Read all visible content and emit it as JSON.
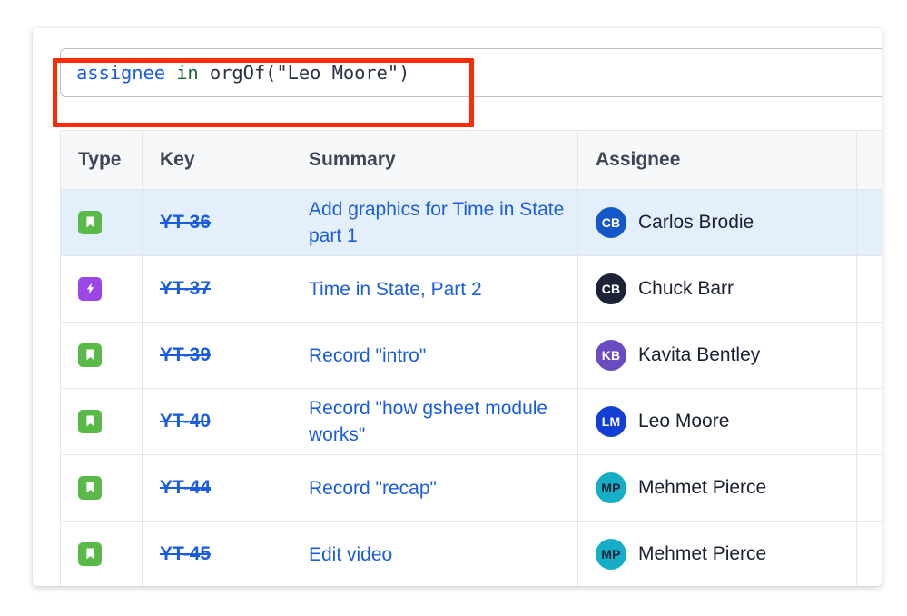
{
  "query": {
    "tokens": [
      {
        "text": "assignee",
        "kind": "field"
      },
      {
        "text": " ",
        "kind": "plain"
      },
      {
        "text": "in",
        "kind": "operator"
      },
      {
        "text": " ",
        "kind": "plain"
      },
      {
        "text": "orgOf(\"Leo Moore\")",
        "kind": "plain"
      }
    ],
    "full_text": "assignee in orgOf(\"Leo Moore\")",
    "annotation_color": "#fb2b05"
  },
  "table": {
    "columns": [
      {
        "key": "type",
        "label": "Type"
      },
      {
        "key": "key",
        "label": "Key"
      },
      {
        "key": "summary",
        "label": "Summary"
      },
      {
        "key": "assignee",
        "label": "Assignee"
      }
    ],
    "rows": [
      {
        "type_icon": "story-icon",
        "type_color": "#5aba47",
        "key": "YT-36",
        "summary": "Add graphics for Time in State part 1",
        "assignee": "Carlos Brodie",
        "initials": "CB",
        "avatar_color": "#1457c8",
        "avatar_text_color": "#ffffff",
        "highlighted": true
      },
      {
        "type_icon": "epic-icon",
        "type_color": "#9b47e8",
        "key": "YT-37",
        "summary": "Time in State, Part 2",
        "assignee": "Chuck Barr",
        "initials": "CB",
        "avatar_color": "#1c2336",
        "avatar_text_color": "#ffffff",
        "highlighted": false
      },
      {
        "type_icon": "story-icon",
        "type_color": "#5aba47",
        "key": "YT-39",
        "summary": "Record \"intro\"",
        "assignee": "Kavita Bentley",
        "initials": "KB",
        "avatar_color": "#6a4cc0",
        "avatar_text_color": "#ffffff",
        "highlighted": false
      },
      {
        "type_icon": "story-icon",
        "type_color": "#5aba47",
        "key": "YT-40",
        "summary": "Record \"how gsheet module works\"",
        "assignee": "Leo Moore",
        "initials": "LM",
        "avatar_color": "#143fd4",
        "avatar_text_color": "#ffffff",
        "highlighted": false
      },
      {
        "type_icon": "story-icon",
        "type_color": "#5aba47",
        "key": "YT-44",
        "summary": "Record \"recap\"",
        "assignee": "Mehmet Pierce",
        "initials": "MP",
        "avatar_color": "#16aec6",
        "avatar_text_color": "#14253a",
        "highlighted": false
      },
      {
        "type_icon": "story-icon",
        "type_color": "#5aba47",
        "key": "YT-45",
        "summary": "Edit video",
        "assignee": "Mehmet Pierce",
        "initials": "MP",
        "avatar_color": "#16aec6",
        "avatar_text_color": "#14253a",
        "highlighted": false
      }
    ]
  }
}
